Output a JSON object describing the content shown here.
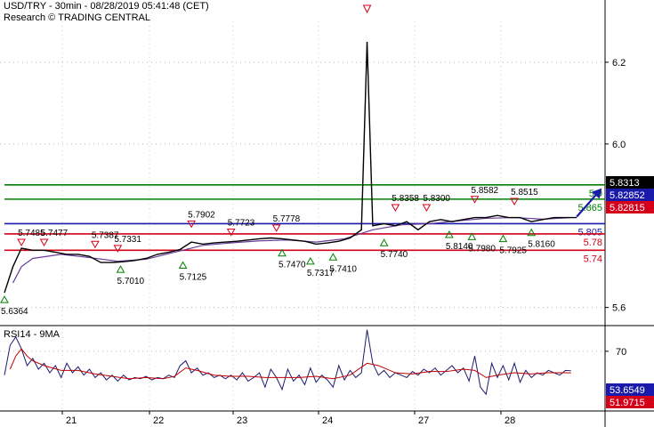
{
  "header": {
    "title": "USD/TRY - 30min - 08/28/2019 05:41:48 (CET)",
    "subtitle": "Research © TRADING CENTRAL"
  },
  "rsi_panel": {
    "title": "RSI14 - 9MA"
  },
  "colors": {
    "resistance": "#008000",
    "pivot": "#1a1aaa",
    "support": "#d4001a",
    "price": "#000000",
    "ma": "#6a3d9a",
    "rsi": "#1a1a6e",
    "rsi_ma": "#c00000"
  },
  "chart_data": [
    {
      "type": "line",
      "name": "USD/TRY 30min price",
      "title": "USD/TRY - 30min - 08/28/2019 05:41:48 (CET)",
      "x_ticks": [
        "21",
        "22",
        "23",
        "24",
        "27",
        "28"
      ],
      "y_ticks": [
        5.6,
        6.0,
        6.2
      ],
      "ylim": [
        5.56,
        6.3
      ],
      "price_path": [
        [
          0.0,
          5.636
        ],
        [
          0.03,
          5.7
        ],
        [
          0.06,
          5.745
        ],
        [
          0.1,
          5.74
        ],
        [
          0.14,
          5.74
        ],
        [
          0.18,
          5.735
        ],
        [
          0.22,
          5.73
        ],
        [
          0.26,
          5.73
        ],
        [
          0.3,
          5.725
        ],
        [
          0.34,
          5.71
        ],
        [
          0.38,
          5.71
        ],
        [
          0.42,
          5.712
        ],
        [
          0.46,
          5.715
        ],
        [
          0.5,
          5.72
        ],
        [
          0.54,
          5.73
        ],
        [
          0.58,
          5.735
        ],
        [
          0.62,
          5.742
        ],
        [
          0.66,
          5.76
        ],
        [
          0.7,
          5.755
        ],
        [
          0.74,
          5.758
        ],
        [
          0.78,
          5.76
        ],
        [
          0.82,
          5.762
        ],
        [
          0.86,
          5.765
        ],
        [
          0.9,
          5.768
        ],
        [
          0.94,
          5.77
        ],
        [
          0.98,
          5.768
        ],
        [
          1.02,
          5.765
        ],
        [
          1.06,
          5.762
        ],
        [
          1.1,
          5.755
        ],
        [
          1.14,
          5.758
        ],
        [
          1.18,
          5.762
        ],
        [
          1.22,
          5.77
        ],
        [
          1.26,
          5.79
        ],
        [
          1.28,
          6.25
        ],
        [
          1.3,
          5.8
        ],
        [
          1.34,
          5.805
        ],
        [
          1.38,
          5.8
        ],
        [
          1.42,
          5.81
        ],
        [
          1.46,
          5.79
        ],
        [
          1.5,
          5.81
        ],
        [
          1.54,
          5.815
        ],
        [
          1.58,
          5.81
        ],
        [
          1.62,
          5.815
        ],
        [
          1.66,
          5.82
        ],
        [
          1.7,
          5.82
        ],
        [
          1.74,
          5.825
        ],
        [
          1.78,
          5.82
        ],
        [
          1.82,
          5.82
        ],
        [
          1.86,
          5.81
        ],
        [
          1.9,
          5.815
        ],
        [
          1.94,
          5.82
        ],
        [
          1.98,
          5.82
        ],
        [
          2.02,
          5.82
        ]
      ],
      "ma_path": [
        [
          0.03,
          5.66
        ],
        [
          0.06,
          5.7
        ],
        [
          0.1,
          5.72
        ],
        [
          0.2,
          5.73
        ],
        [
          0.3,
          5.722
        ],
        [
          0.4,
          5.713
        ],
        [
          0.5,
          5.718
        ],
        [
          0.6,
          5.735
        ],
        [
          0.7,
          5.752
        ],
        [
          0.8,
          5.758
        ],
        [
          0.9,
          5.763
        ],
        [
          1.0,
          5.765
        ],
        [
          1.1,
          5.76
        ],
        [
          1.2,
          5.768
        ],
        [
          1.3,
          5.79
        ],
        [
          1.4,
          5.802
        ],
        [
          1.5,
          5.805
        ],
        [
          1.6,
          5.812
        ],
        [
          1.7,
          5.818
        ],
        [
          1.8,
          5.82
        ],
        [
          1.9,
          5.816
        ],
        [
          2.0,
          5.82
        ]
      ],
      "forecast_arrow": {
        "from": [
          2.02,
          5.822
        ],
        "to": [
          2.1,
          5.885
        ]
      },
      "levels": [
        {
          "name": "resistance-2",
          "value": 5.9,
          "label": "5.9",
          "kind": "resistance"
        },
        {
          "name": "resistance-1",
          "value": 5.865,
          "label": "5.865",
          "kind": "resistance"
        },
        {
          "name": "pivot",
          "value": 5.805,
          "label": "5.805",
          "kind": "pivot"
        },
        {
          "name": "support-1",
          "value": 5.78,
          "label": "5.78",
          "kind": "support"
        },
        {
          "name": "support-2",
          "value": 5.74,
          "label": "5.74",
          "kind": "support"
        }
      ],
      "price_boxes": [
        {
          "label": "5.8313",
          "value": 5.8313,
          "bg": "#000000"
        },
        {
          "label": "5.82852",
          "value": 5.8285,
          "bg": "#1a1aaa"
        },
        {
          "label": "5.82815",
          "value": 5.8255,
          "bg": "#d4001a"
        }
      ],
      "annotations": [
        {
          "label": "5.6364",
          "x": 0.0,
          "y": 5.636,
          "type": "low"
        },
        {
          "label": "5.7485",
          "x": 0.06,
          "y": 5.745,
          "type": "high"
        },
        {
          "label": "5.7477",
          "x": 0.14,
          "y": 5.745,
          "type": "high"
        },
        {
          "label": "5.7387",
          "x": 0.32,
          "y": 5.74,
          "type": "high"
        },
        {
          "label": "5.7331",
          "x": 0.4,
          "y": 5.73,
          "type": "high"
        },
        {
          "label": "5.7010",
          "x": 0.41,
          "y": 5.71,
          "type": "low"
        },
        {
          "label": "5.7902",
          "x": 0.66,
          "y": 5.79,
          "type": "high"
        },
        {
          "label": "5.7125",
          "x": 0.63,
          "y": 5.72,
          "type": "low"
        },
        {
          "label": "5.7723",
          "x": 0.8,
          "y": 5.77,
          "type": "high"
        },
        {
          "label": "5.7778",
          "x": 0.96,
          "y": 5.78,
          "type": "high"
        },
        {
          "label": "5.7470",
          "x": 0.98,
          "y": 5.75,
          "type": "low"
        },
        {
          "label": "5.7317",
          "x": 1.08,
          "y": 5.73,
          "type": "low"
        },
        {
          "label": "5.7410",
          "x": 1.16,
          "y": 5.74,
          "type": "low"
        },
        {
          "label": "5.7740",
          "x": 1.34,
          "y": 5.775,
          "type": "low"
        },
        {
          "label": "5.8358",
          "x": 1.38,
          "y": 5.83,
          "type": "high"
        },
        {
          "label": "5.8300",
          "x": 1.49,
          "y": 5.83,
          "type": "high"
        },
        {
          "label": "5.8140",
          "x": 1.57,
          "y": 5.795,
          "type": "low"
        },
        {
          "label": "5.8582",
          "x": 1.66,
          "y": 5.85,
          "type": "high"
        },
        {
          "label": "5.7980",
          "x": 1.65,
          "y": 5.79,
          "type": "low"
        },
        {
          "label": "5.8515",
          "x": 1.8,
          "y": 5.845,
          "type": "high"
        },
        {
          "label": "5.7925",
          "x": 1.76,
          "y": 5.785,
          "type": "low"
        },
        {
          "label": "5.8160",
          "x": 1.86,
          "y": 5.8,
          "type": "low"
        }
      ],
      "spike_marker": {
        "x": 1.28,
        "y": 6.27
      }
    },
    {
      "type": "line",
      "name": "RSI14 - 9MA",
      "title": "RSI14 - 9MA",
      "y_ticks": [
        70
      ],
      "ylim": [
        20,
        90
      ],
      "boxes": [
        {
          "label": "53.6549",
          "value": 53.6549,
          "bg": "#1a1aaa"
        },
        {
          "label": "51.9715",
          "value": 51.9715,
          "bg": "#d4001a"
        }
      ],
      "rsi": [
        [
          0.0,
          50
        ],
        [
          0.02,
          75
        ],
        [
          0.04,
          82
        ],
        [
          0.06,
          72
        ],
        [
          0.08,
          58
        ],
        [
          0.1,
          64
        ],
        [
          0.12,
          55
        ],
        [
          0.14,
          60
        ],
        [
          0.16,
          52
        ],
        [
          0.18,
          58
        ],
        [
          0.2,
          48
        ],
        [
          0.22,
          60
        ],
        [
          0.24,
          52
        ],
        [
          0.26,
          57
        ],
        [
          0.28,
          50
        ],
        [
          0.3,
          55
        ],
        [
          0.32,
          48
        ],
        [
          0.34,
          52
        ],
        [
          0.36,
          46
        ],
        [
          0.38,
          50
        ],
        [
          0.4,
          45
        ],
        [
          0.42,
          50
        ],
        [
          0.44,
          46
        ],
        [
          0.46,
          48
        ],
        [
          0.48,
          47
        ],
        [
          0.5,
          49
        ],
        [
          0.52,
          46
        ],
        [
          0.54,
          48
        ],
        [
          0.56,
          47
        ],
        [
          0.58,
          50
        ],
        [
          0.6,
          48
        ],
        [
          0.62,
          58
        ],
        [
          0.64,
          62
        ],
        [
          0.66,
          52
        ],
        [
          0.68,
          56
        ],
        [
          0.7,
          50
        ],
        [
          0.72,
          52
        ],
        [
          0.74,
          48
        ],
        [
          0.76,
          50
        ],
        [
          0.78,
          47
        ],
        [
          0.8,
          50
        ],
        [
          0.82,
          46
        ],
        [
          0.84,
          52
        ],
        [
          0.86,
          45
        ],
        [
          0.88,
          48
        ],
        [
          0.9,
          52
        ],
        [
          0.92,
          40
        ],
        [
          0.94,
          55
        ],
        [
          0.96,
          48
        ],
        [
          0.98,
          38
        ],
        [
          1.0,
          55
        ],
        [
          1.02,
          45
        ],
        [
          1.04,
          50
        ],
        [
          1.06,
          42
        ],
        [
          1.08,
          56
        ],
        [
          1.1,
          44
        ],
        [
          1.12,
          50
        ],
        [
          1.14,
          46
        ],
        [
          1.16,
          40
        ],
        [
          1.18,
          58
        ],
        [
          1.2,
          46
        ],
        [
          1.22,
          54
        ],
        [
          1.24,
          48
        ],
        [
          1.26,
          52
        ],
        [
          1.28,
          88
        ],
        [
          1.3,
          60
        ],
        [
          1.32,
          50
        ],
        [
          1.34,
          54
        ],
        [
          1.36,
          48
        ],
        [
          1.38,
          52
        ],
        [
          1.4,
          50
        ],
        [
          1.42,
          48
        ],
        [
          1.44,
          53
        ],
        [
          1.46,
          50
        ],
        [
          1.48,
          55
        ],
        [
          1.5,
          52
        ],
        [
          1.52,
          56
        ],
        [
          1.54,
          50
        ],
        [
          1.56,
          54
        ],
        [
          1.58,
          58
        ],
        [
          1.6,
          52
        ],
        [
          1.62,
          56
        ],
        [
          1.64,
          45
        ],
        [
          1.66,
          66
        ],
        [
          1.68,
          40
        ],
        [
          1.7,
          34
        ],
        [
          1.72,
          60
        ],
        [
          1.74,
          48
        ],
        [
          1.76,
          58
        ],
        [
          1.78,
          46
        ],
        [
          1.8,
          60
        ],
        [
          1.82,
          44
        ],
        [
          1.84,
          54
        ],
        [
          1.86,
          48
        ],
        [
          1.88,
          52
        ],
        [
          1.9,
          50
        ],
        [
          1.92,
          54
        ],
        [
          1.94,
          52
        ],
        [
          1.96,
          50
        ],
        [
          1.98,
          54
        ],
        [
          2.0,
          53.65
        ]
      ],
      "rsi_ma": [
        [
          0.02,
          55
        ],
        [
          0.04,
          66
        ],
        [
          0.06,
          72
        ],
        [
          0.08,
          66
        ],
        [
          0.1,
          62
        ],
        [
          0.14,
          58
        ],
        [
          0.2,
          54
        ],
        [
          0.26,
          54
        ],
        [
          0.32,
          51
        ],
        [
          0.38,
          49
        ],
        [
          0.44,
          47
        ],
        [
          0.5,
          48
        ],
        [
          0.56,
          47
        ],
        [
          0.6,
          49
        ],
        [
          0.64,
          56
        ],
        [
          0.68,
          54
        ],
        [
          0.74,
          50
        ],
        [
          0.8,
          49
        ],
        [
          0.86,
          49
        ],
        [
          0.92,
          48
        ],
        [
          0.98,
          48
        ],
        [
          1.04,
          48
        ],
        [
          1.1,
          49
        ],
        [
          1.16,
          47
        ],
        [
          1.22,
          50
        ],
        [
          1.28,
          60
        ],
        [
          1.32,
          58
        ],
        [
          1.38,
          52
        ],
        [
          1.44,
          51
        ],
        [
          1.5,
          53
        ],
        [
          1.56,
          53
        ],
        [
          1.62,
          55
        ],
        [
          1.66,
          54
        ],
        [
          1.7,
          48
        ],
        [
          1.74,
          50
        ],
        [
          1.8,
          52
        ],
        [
          1.86,
          51
        ],
        [
          1.92,
          52
        ],
        [
          2.0,
          51.97
        ]
      ]
    }
  ]
}
